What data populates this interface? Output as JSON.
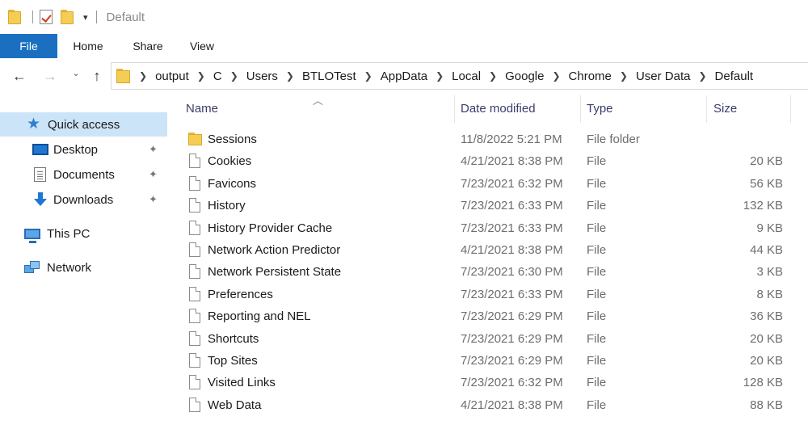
{
  "window": {
    "title": "Default"
  },
  "ribbon": {
    "tabs": [
      "File",
      "Home",
      "Share",
      "View"
    ]
  },
  "nav": {
    "back": "←",
    "forward": "→",
    "recent": "⌄",
    "up": "↑"
  },
  "address": {
    "crumbs": [
      "output",
      "C",
      "Users",
      "BTLOTest",
      "AppData",
      "Local",
      "Google",
      "Chrome",
      "User Data",
      "Default"
    ]
  },
  "sidebar": {
    "quick_access": "Quick access",
    "desktop": "Desktop",
    "documents": "Documents",
    "downloads": "Downloads",
    "this_pc": "This PC",
    "network": "Network",
    "pin_glyph": "📌"
  },
  "columns": {
    "name": "Name",
    "date_modified": "Date modified",
    "type": "Type",
    "size": "Size"
  },
  "files": [
    {
      "icon": "folder-icon",
      "name": "Sessions",
      "date": "11/8/2022 5:21 PM",
      "type": "File folder",
      "size": ""
    },
    {
      "icon": "file-icon",
      "name": "Cookies",
      "date": "4/21/2021 8:38 PM",
      "type": "File",
      "size": "20 KB"
    },
    {
      "icon": "file-icon",
      "name": "Favicons",
      "date": "7/23/2021 6:32 PM",
      "type": "File",
      "size": "56 KB"
    },
    {
      "icon": "file-icon",
      "name": "History",
      "date": "7/23/2021 6:33 PM",
      "type": "File",
      "size": "132 KB"
    },
    {
      "icon": "file-icon",
      "name": "History Provider Cache",
      "date": "7/23/2021 6:33 PM",
      "type": "File",
      "size": "9 KB"
    },
    {
      "icon": "file-icon",
      "name": "Network Action Predictor",
      "date": "4/21/2021 8:38 PM",
      "type": "File",
      "size": "44 KB"
    },
    {
      "icon": "file-icon",
      "name": "Network Persistent State",
      "date": "7/23/2021 6:30 PM",
      "type": "File",
      "size": "3 KB"
    },
    {
      "icon": "file-icon",
      "name": "Preferences",
      "date": "7/23/2021 6:33 PM",
      "type": "File",
      "size": "8 KB"
    },
    {
      "icon": "file-icon",
      "name": "Reporting and NEL",
      "date": "7/23/2021 6:29 PM",
      "type": "File",
      "size": "36 KB"
    },
    {
      "icon": "file-icon",
      "name": "Shortcuts",
      "date": "7/23/2021 6:29 PM",
      "type": "File",
      "size": "20 KB"
    },
    {
      "icon": "file-icon",
      "name": "Top Sites",
      "date": "7/23/2021 6:29 PM",
      "type": "File",
      "size": "20 KB"
    },
    {
      "icon": "file-icon",
      "name": "Visited Links",
      "date": "7/23/2021 6:32 PM",
      "type": "File",
      "size": "128 KB"
    },
    {
      "icon": "file-icon",
      "name": "Web Data",
      "date": "4/21/2021 8:38 PM",
      "type": "File",
      "size": "88 KB"
    }
  ],
  "colors": {
    "accent": "#1a6fc0",
    "selection": "#cce4f7",
    "folder": "#f5cd55"
  }
}
